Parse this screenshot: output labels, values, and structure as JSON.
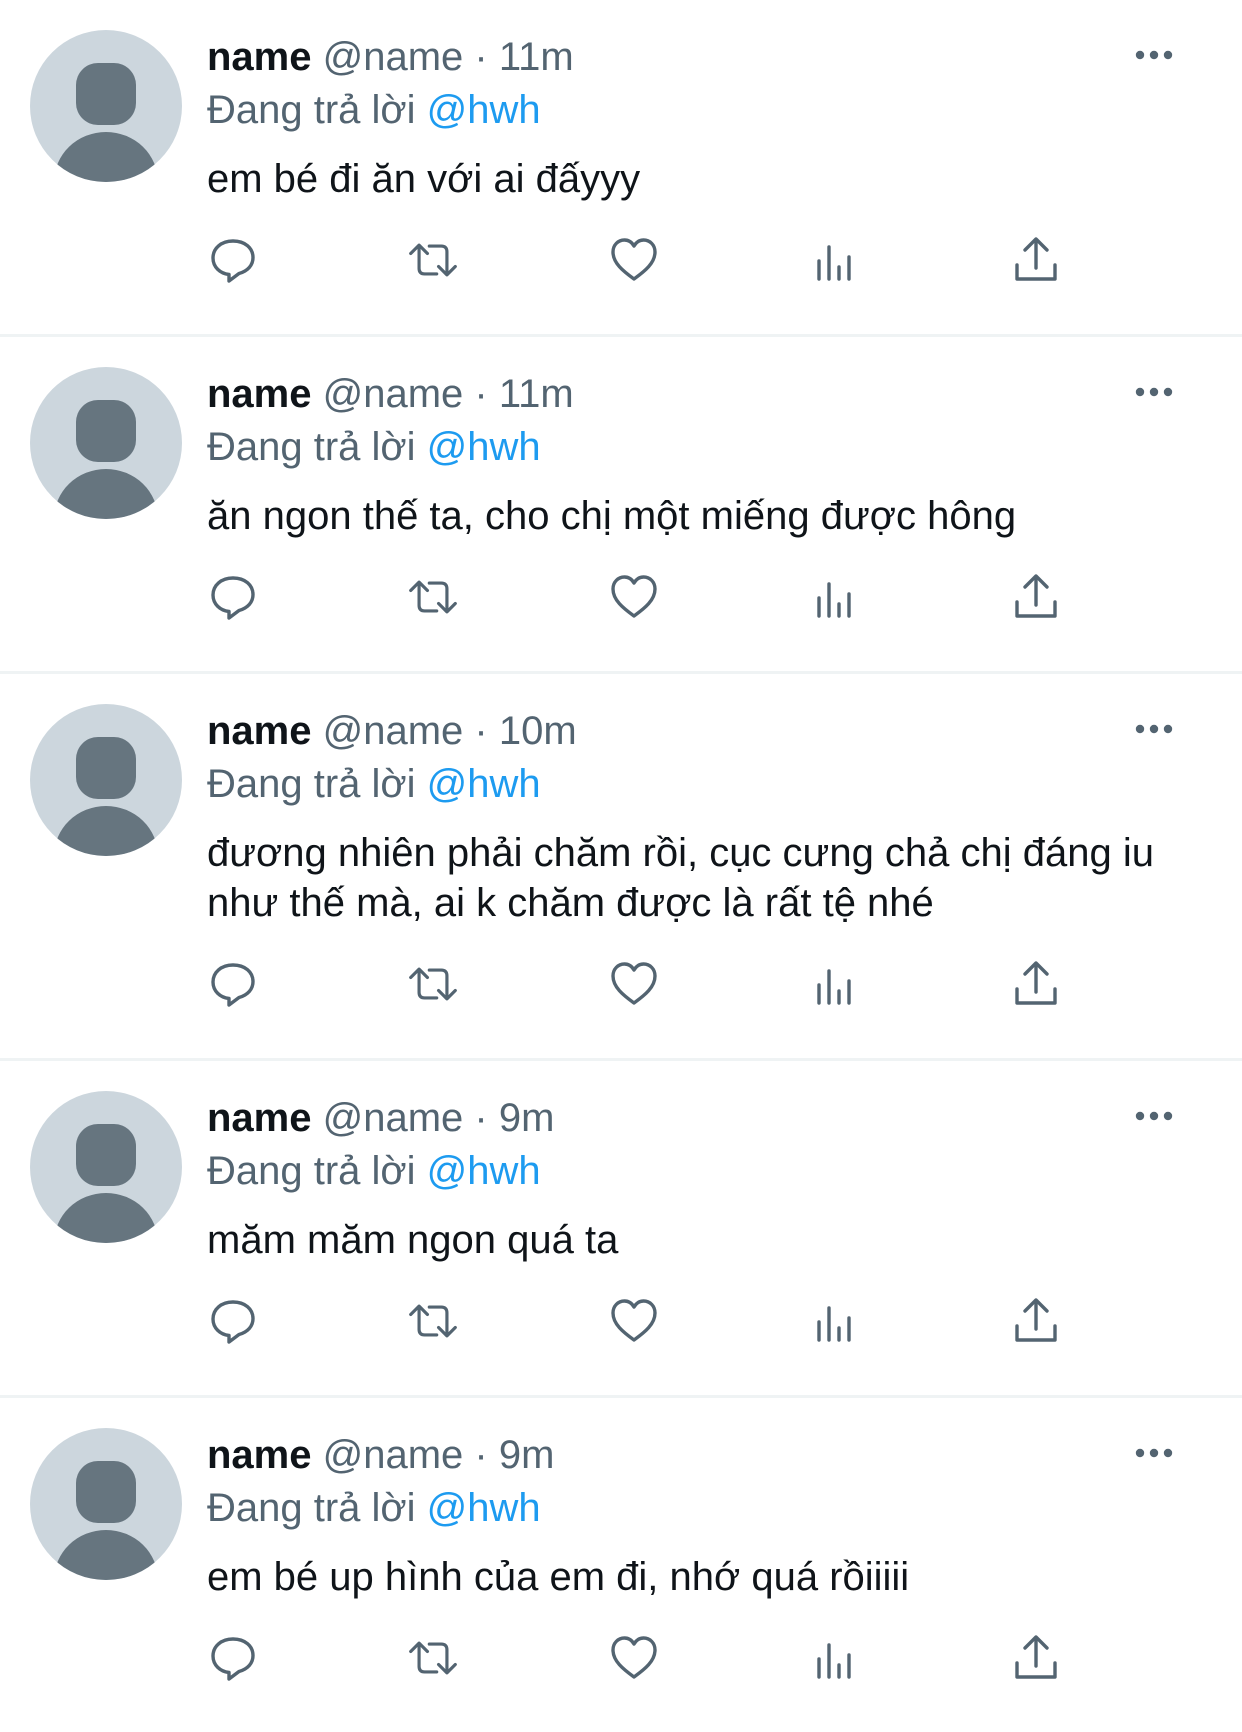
{
  "colors": {
    "text": "#0f1419",
    "secondary": "#536471",
    "accent": "#1d9bf0",
    "avatar_bg": "#ccd6dd",
    "avatar_fg": "#66757f",
    "divider": "#eff3f4"
  },
  "icons": [
    "more-icon",
    "reply-icon",
    "retweet-icon",
    "like-icon",
    "views-icon",
    "share-icon"
  ],
  "tweets": [
    {
      "name": "name",
      "handle": "@name",
      "sep": "·",
      "time": "11m",
      "reply_prefix": "Đang trả lời",
      "reply_to": "@hwh",
      "text": "em bé đi ăn với ai đấyyy"
    },
    {
      "name": "name",
      "handle": "@name",
      "sep": "·",
      "time": "11m",
      "reply_prefix": "Đang trả lời",
      "reply_to": "@hwh",
      "text": "ăn ngon thế ta, cho chị một miếng được hông"
    },
    {
      "name": "name",
      "handle": "@name",
      "sep": "·",
      "time": "10m",
      "reply_prefix": "Đang trả lời",
      "reply_to": "@hwh",
      "text": "đương nhiên phải chăm rồi, cục cưng chả chị đáng iu như thế mà, ai k chăm được là rất tệ nhé"
    },
    {
      "name": "name",
      "handle": "@name",
      "sep": "·",
      "time": "9m",
      "reply_prefix": "Đang trả lời",
      "reply_to": "@hwh",
      "text": "măm măm ngon quá ta"
    },
    {
      "name": "name",
      "handle": "@name",
      "sep": "·",
      "time": "9m",
      "reply_prefix": "Đang trả lời",
      "reply_to": "@hwh",
      "text": "em bé up hình của em đi, nhớ quá rồiiiii"
    }
  ]
}
